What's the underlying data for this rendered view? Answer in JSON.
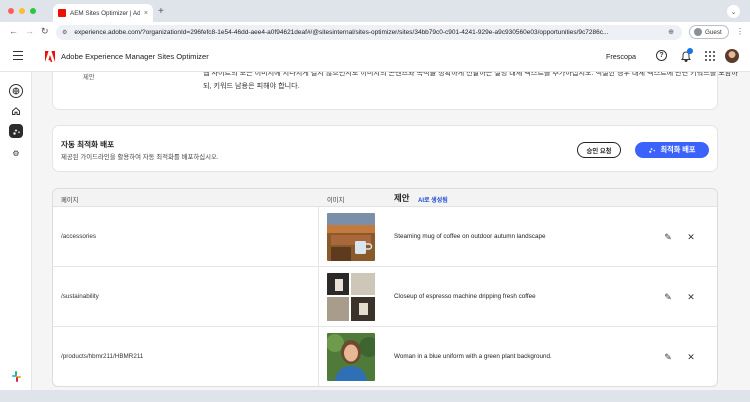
{
  "browser": {
    "tab_title": "AEM Sites Optimizer | Adob",
    "tab_close": "×",
    "new_tab": "+",
    "url": "experience.adobe.com/?organizationId=296fefc8-1e54-46dd-aee4-a0f94621deaf#/@sitesinternal/sites-optimizer/sites/34bb79c0-c901-4241-929e-a9c930560e03/opportunities/9c7286c...",
    "profile_label": "Guest"
  },
  "header": {
    "app_title": "Adobe Experience Manager Sites Optimizer",
    "org_name": "Frescopa",
    "help_glyph": "?"
  },
  "suggestion_panel": {
    "label": "제안",
    "text": "웹 사이트의 모든 이미지에 지나치게 길지 않으면서도 이미지의 콘텐츠와 목적을 정확하게 전달하는 설명 대체 텍스트를 추가하십시오. 적절한 경우 대체 텍스트에 관련 키워드를 포함하되, 키워드 남용은 피해야 합니다."
  },
  "auto_optimize": {
    "title": "자동 최적화 배포",
    "description": "제공된 가이드라인을 활용하여 자동 최적화를 배포하십시오.",
    "request_button": "승인 요청",
    "deploy_button": "최적화 배포"
  },
  "table": {
    "headers": {
      "page": "페이지",
      "image": "이미지",
      "suggestion": "제안",
      "ai_badge": "AI로 생성됨"
    },
    "rows": [
      {
        "page": "/accessories",
        "alt": "Steaming mug of coffee on outdoor autumn landscape",
        "image": "coffee-mug-photo"
      },
      {
        "page": "/sustainability",
        "alt": "Closeup of espresso machine dripping fresh coffee",
        "image": "espresso-machine-photo"
      },
      {
        "page": "/products/hbmr211/HBMR211",
        "alt": "Woman in a blue uniform with a green plant background.",
        "image": "woman-portrait-photo"
      }
    ]
  },
  "colors": {
    "accent": "#3b63fb",
    "adobe_red": "#eb1000"
  }
}
